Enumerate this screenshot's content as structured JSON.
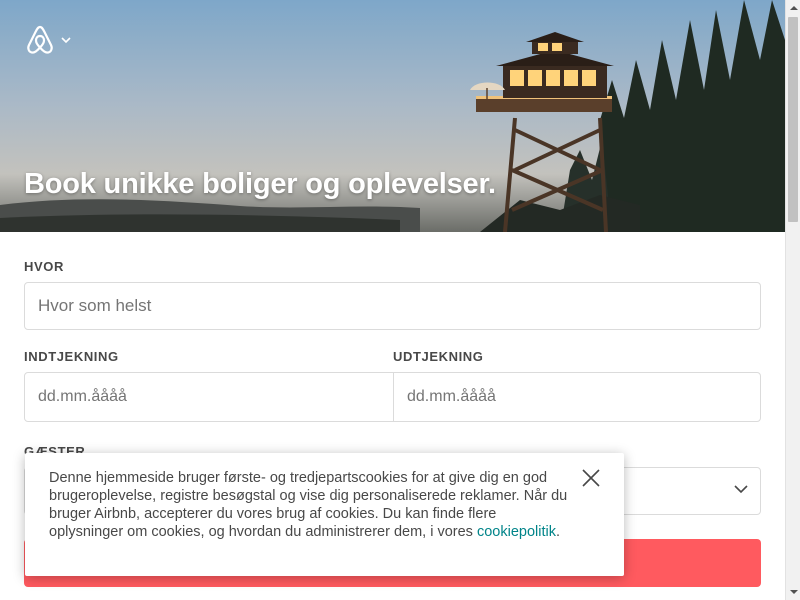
{
  "hero": {
    "title": "Book unikke boliger og oplevelser.",
    "logo_icon": "airbnb-logo-icon",
    "menu_icon": "chevron-down-icon"
  },
  "search_form": {
    "where": {
      "label": "HVOR",
      "placeholder": "Hvor som helst"
    },
    "checkin": {
      "label": "INDTJEKNING",
      "placeholder": "dd.mm.åååå"
    },
    "checkout": {
      "label": "UDTJEKNING",
      "placeholder": "dd.mm.åååå"
    },
    "guests": {
      "label": "GÆSTER",
      "icon": "chevron-down-icon"
    },
    "search_button_color": "#ff5a5f"
  },
  "cookie_banner": {
    "text": "Denne hjemmeside bruger første- og tredjepartscookies for at give dig en god brugeroplevelse, registre besøgstal og vise dig personaliserede reklamer. Når du bruger Airbnb, accepterer du vores brug af cookies. Du kan finde flere oplysninger om cookies, og hvordan du administrerer dem, i vores ",
    "link_text": "cookiepolitik",
    "suffix": ".",
    "close_icon": "close-icon"
  },
  "colors": {
    "brand": "#ff5a5f",
    "link": "#008489",
    "text": "#484848"
  }
}
